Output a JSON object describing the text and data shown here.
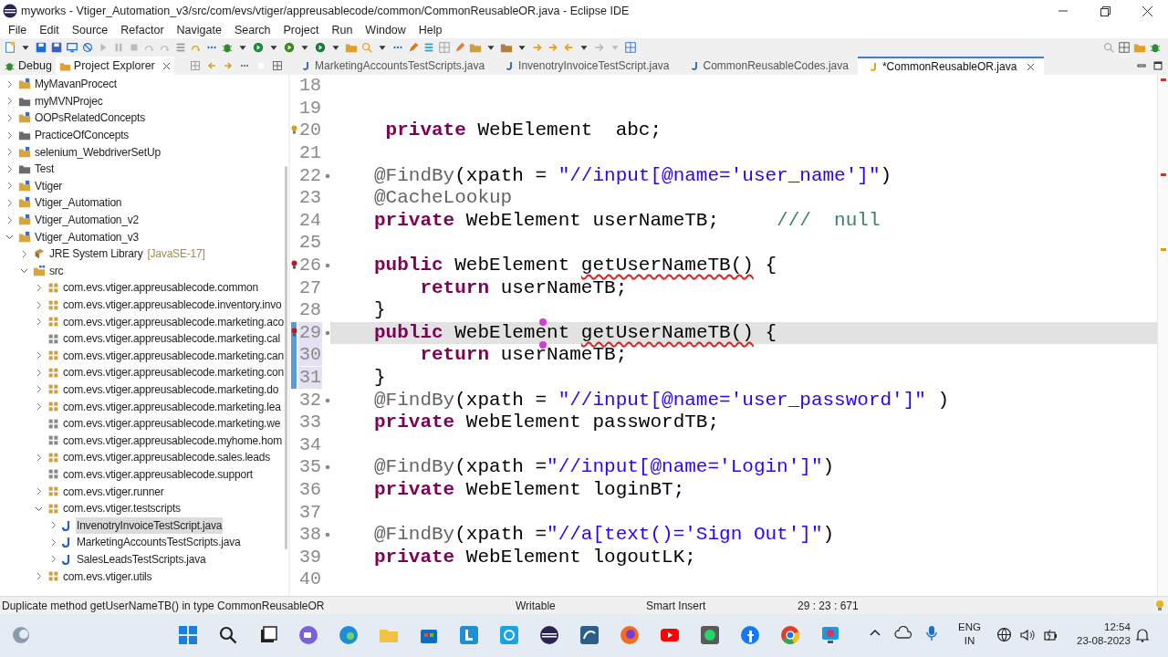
{
  "window": {
    "title": "myworks - Vtiger_Automation_v3/src/com/evs/vtiger/appreusablecode/common/CommonReusableOR.java - Eclipse IDE"
  },
  "menu": [
    "File",
    "Edit",
    "Source",
    "Refactor",
    "Navigate",
    "Search",
    "Project",
    "Run",
    "Window",
    "Help"
  ],
  "side_tabs": [
    {
      "label": "Debug",
      "kind": "debug",
      "selected": false
    },
    {
      "label": "Project Explorer",
      "kind": "explorer",
      "selected": true
    }
  ],
  "tree": [
    {
      "label": "MyMavanProcect",
      "kind": "project",
      "expanded": false,
      "selected": false
    },
    {
      "label": "myMVNProjec",
      "kind": "closed_project",
      "expanded": false,
      "selected": false
    },
    {
      "label": "OOPsRelatedConcepts",
      "kind": "project",
      "expanded": false,
      "selected": false
    },
    {
      "label": "PracticeOfConcepts",
      "kind": "closed_project",
      "expanded": false,
      "selected": false
    },
    {
      "label": "selenium_WebdriverSetUp",
      "kind": "project",
      "expanded": false,
      "selected": false
    },
    {
      "label": "Test",
      "kind": "closed_project",
      "expanded": false,
      "selected": false
    },
    {
      "label": "Vtiger",
      "kind": "project",
      "expanded": false,
      "selected": false
    },
    {
      "label": "Vtiger_Automation",
      "kind": "project",
      "expanded": false,
      "selected": false
    },
    {
      "label": "Vtiger_Automation_v2",
      "kind": "project",
      "expanded": false,
      "selected": false
    },
    {
      "label": "Vtiger_Automation_v3",
      "kind": "project",
      "expanded": true,
      "selected": false,
      "children": [
        {
          "label": "JRE System Library",
          "suffix": "[JavaSE-17]",
          "kind": "library",
          "expanded": false,
          "selected": false
        },
        {
          "label": "src",
          "kind": "source_folder",
          "expanded": true,
          "selected": false,
          "children": [
            {
              "label": "com.evs.vtiger.appreusablecode.common",
              "kind": "package",
              "expanded": false,
              "selected": false
            },
            {
              "label": "com.evs.vtiger.appreusablecode.inventory.invo",
              "kind": "package",
              "expanded": false,
              "selected": false
            },
            {
              "label": "com.evs.vtiger.appreusablecode.marketing.aco",
              "kind": "package",
              "expanded": false,
              "selected": false
            },
            {
              "label": "com.evs.vtiger.appreusablecode.marketing.cal",
              "kind": "empty_package",
              "selected": false
            },
            {
              "label": "com.evs.vtiger.appreusablecode.marketing.can",
              "kind": "package",
              "expanded": false,
              "selected": false
            },
            {
              "label": "com.evs.vtiger.appreusablecode.marketing.con",
              "kind": "package",
              "expanded": false,
              "selected": false
            },
            {
              "label": "com.evs.vtiger.appreusablecode.marketing.do",
              "kind": "package",
              "expanded": false,
              "selected": false
            },
            {
              "label": "com.evs.vtiger.appreusablecode.marketing.lea",
              "kind": "package",
              "expanded": false,
              "selected": false
            },
            {
              "label": "com.evs.vtiger.appreusablecode.marketing.we",
              "kind": "empty_package",
              "selected": false
            },
            {
              "label": "com.evs.vtiger.appreusablecode.myhome.hom",
              "kind": "empty_package",
              "selected": false
            },
            {
              "label": "com.evs.vtiger.appreusablecode.sales.leads",
              "kind": "package",
              "expanded": false,
              "selected": false
            },
            {
              "label": "com.evs.vtiger.appreusablecode.support",
              "kind": "empty_package",
              "selected": false
            },
            {
              "label": "com.evs.vtiger.runner",
              "kind": "package",
              "expanded": false,
              "selected": false
            },
            {
              "label": "com.evs.vtiger.testscripts",
              "kind": "package",
              "expanded": true,
              "selected": false,
              "children": [
                {
                  "label": "InvenotryInvoiceTestScript.java",
                  "kind": "java_file",
                  "expanded": false,
                  "selected": true
                },
                {
                  "label": "MarketingAccountsTestScripts.java",
                  "kind": "java_file",
                  "expanded": false,
                  "selected": false
                },
                {
                  "label": "SalesLeadsTestScripts.java",
                  "kind": "java_file",
                  "expanded": false,
                  "selected": false
                }
              ]
            },
            {
              "label": "com.evs.vtiger.utils",
              "kind": "package",
              "expanded": false,
              "selected": false
            }
          ]
        }
      ]
    }
  ],
  "editor_tabs": [
    {
      "label": "MarketingAccountsTestScripts.java",
      "selected": false
    },
    {
      "label": "InvenotryInvoiceTestScript.java",
      "selected": false
    },
    {
      "label": "CommonReusableCodes.java",
      "selected": false
    },
    {
      "label": "*CommonReusableOR.java",
      "selected": true
    }
  ],
  "code_lines": [
    {
      "number": "18",
      "warning": false,
      "error": false,
      "fold": false,
      "current": false,
      "changed": false
    },
    {
      "number": "19",
      "warning": false,
      "error": false,
      "fold": false,
      "current": false,
      "changed": false
    },
    {
      "number": "20",
      "warning": true,
      "error": false,
      "fold": false,
      "current": false,
      "changed": false,
      "tokens": [
        {
          "kind": "keyword",
          "text": " private"
        },
        {
          "kind": "plain",
          "text": " WebElement  abc;"
        }
      ]
    },
    {
      "number": "21",
      "warning": false,
      "error": false,
      "fold": false,
      "current": false,
      "changed": false
    },
    {
      "number": "22",
      "warning": false,
      "error": false,
      "fold": true,
      "current": false,
      "changed": false,
      "tokens": [
        {
          "kind": "annotation",
          "text": "@FindBy"
        },
        {
          "kind": "plain",
          "text": "(xpath = "
        },
        {
          "kind": "string",
          "text": "\"//input[@name='user_name']\""
        },
        {
          "kind": "plain",
          "text": ")"
        }
      ]
    },
    {
      "number": "23",
      "warning": false,
      "error": false,
      "fold": false,
      "current": false,
      "changed": false,
      "tokens": [
        {
          "kind": "annotation",
          "text": "@CacheLookup"
        }
      ]
    },
    {
      "number": "24",
      "warning": false,
      "error": false,
      "fold": false,
      "current": false,
      "changed": false,
      "tokens": [
        {
          "kind": "keyword",
          "text": "private"
        },
        {
          "kind": "plain",
          "text": " WebElement userNameTB;     "
        },
        {
          "kind": "comment",
          "text": "///  null"
        }
      ]
    },
    {
      "number": "25",
      "warning": false,
      "error": false,
      "fold": false,
      "current": false,
      "changed": false
    },
    {
      "number": "26",
      "warning": false,
      "error": true,
      "fold": true,
      "current": false,
      "changed": false,
      "tokens": [
        {
          "kind": "keyword",
          "text": "public"
        },
        {
          "kind": "plain",
          "text": " WebElement "
        },
        {
          "kind": "error",
          "text": "getUserNameTB()"
        },
        {
          "kind": "plain",
          "text": " {"
        }
      ]
    },
    {
      "number": "27",
      "warning": false,
      "error": false,
      "fold": false,
      "current": false,
      "changed": false,
      "tokens": [
        {
          "kind": "keyword",
          "text": "    return"
        },
        {
          "kind": "plain",
          "text": " userNameTB;"
        }
      ]
    },
    {
      "number": "28",
      "warning": false,
      "error": false,
      "fold": false,
      "current": false,
      "changed": false,
      "tokens": [
        {
          "kind": "plain",
          "text": "}"
        }
      ]
    },
    {
      "number": "29",
      "warning": false,
      "error": true,
      "fold": true,
      "current": true,
      "changed": true,
      "tokens": [
        {
          "kind": "keyword",
          "text": "public"
        },
        {
          "kind": "plain",
          "text": " WebElement "
        },
        {
          "kind": "error",
          "text": "getUserNameTB()"
        },
        {
          "kind": "plain",
          "text": " {"
        }
      ]
    },
    {
      "number": "30",
      "warning": false,
      "error": false,
      "fold": false,
      "current": false,
      "changed": true,
      "tokens": [
        {
          "kind": "keyword",
          "text": "    return"
        },
        {
          "kind": "plain",
          "text": " userNameTB;"
        }
      ]
    },
    {
      "number": "31",
      "warning": false,
      "error": false,
      "fold": false,
      "current": false,
      "changed": true,
      "tokens": [
        {
          "kind": "plain",
          "text": "}"
        }
      ]
    },
    {
      "number": "32",
      "warning": false,
      "error": false,
      "fold": true,
      "current": false,
      "changed": false,
      "tokens": [
        {
          "kind": "annotation",
          "text": "@FindBy"
        },
        {
          "kind": "plain",
          "text": "(xpath = "
        },
        {
          "kind": "string",
          "text": "\"//input[@name='user_password']\""
        },
        {
          "kind": "plain",
          "text": " )"
        }
      ]
    },
    {
      "number": "33",
      "warning": false,
      "error": false,
      "fold": false,
      "current": false,
      "changed": false,
      "tokens": [
        {
          "kind": "keyword",
          "text": "private"
        },
        {
          "kind": "plain",
          "text": " WebElement passwordTB;"
        }
      ]
    },
    {
      "number": "34",
      "warning": false,
      "error": false,
      "fold": false,
      "current": false,
      "changed": false
    },
    {
      "number": "35",
      "warning": false,
      "error": false,
      "fold": true,
      "current": false,
      "changed": false,
      "tokens": [
        {
          "kind": "annotation",
          "text": "@FindBy"
        },
        {
          "kind": "plain",
          "text": "(xpath ="
        },
        {
          "kind": "string",
          "text": "\"//input[@name='Login']\""
        },
        {
          "kind": "plain",
          "text": ")"
        }
      ]
    },
    {
      "number": "36",
      "warning": false,
      "error": false,
      "fold": false,
      "current": false,
      "changed": false,
      "tokens": [
        {
          "kind": "keyword",
          "text": "private"
        },
        {
          "kind": "plain",
          "text": " WebElement loginBT;"
        }
      ]
    },
    {
      "number": "37",
      "warning": false,
      "error": false,
      "fold": false,
      "current": false,
      "changed": false
    },
    {
      "number": "38",
      "warning": false,
      "error": false,
      "fold": true,
      "current": false,
      "changed": false,
      "tokens": [
        {
          "kind": "annotation",
          "text": "@FindBy"
        },
        {
          "kind": "plain",
          "text": "(xpath ="
        },
        {
          "kind": "string",
          "text": "\"//a[text()='Sign Out']\""
        },
        {
          "kind": "plain",
          "text": ")"
        }
      ]
    },
    {
      "number": "39",
      "warning": false,
      "error": false,
      "fold": false,
      "current": false,
      "changed": false,
      "tokens": [
        {
          "kind": "keyword",
          "text": "private"
        },
        {
          "kind": "plain",
          "text": " WebElement logoutLK;"
        }
      ]
    },
    {
      "number": "40",
      "warning": false,
      "error": false,
      "fold": false,
      "current": false,
      "changed": false
    }
  ],
  "status_bar": {
    "message": "Duplicate method getUserNameTB() in type CommonReusableOR",
    "mode": "Writable",
    "insert_mode": "Smart Insert",
    "position": "29 : 23 : 671"
  },
  "taskbar": {
    "language": "ENG",
    "region": "IN",
    "time": "12:54",
    "date": "23-08-2023"
  }
}
